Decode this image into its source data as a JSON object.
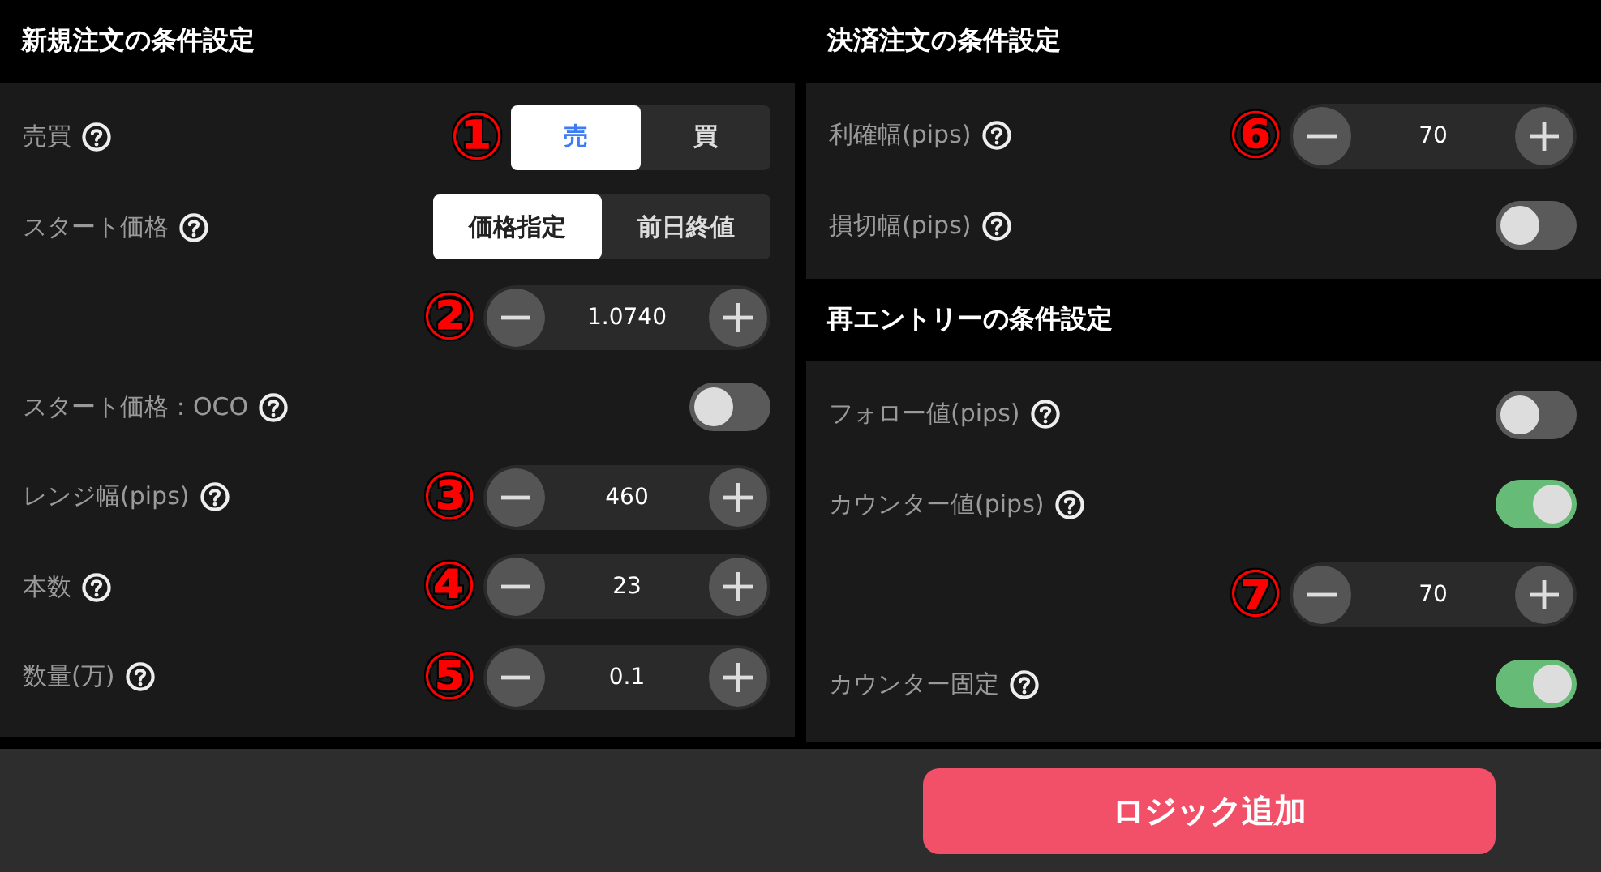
{
  "left": [
    {
      "title": "新規注文の条件設定",
      "rows": [
        {
          "kind": "segmented",
          "label": "売買",
          "help": true,
          "marker": "①",
          "options": [
            {
              "label": "売",
              "selected": true,
              "color": "#3d7cf5"
            },
            {
              "label": "買",
              "selected": false,
              "color": "#dddddd"
            }
          ]
        },
        {
          "kind": "segmented",
          "label": "スタート価格",
          "help": true,
          "options": [
            {
              "label": "価格指定",
              "selected": true,
              "color": "#222222"
            },
            {
              "label": "前日終値",
              "selected": false,
              "color": "#dddddd"
            }
          ]
        },
        {
          "kind": "stepper",
          "marker": "②",
          "value": "1.0740"
        },
        {
          "kind": "toggle",
          "label": "スタート価格：OCO",
          "help": true,
          "on": false
        },
        {
          "kind": "stepper",
          "label": "レンジ幅(pips)",
          "help": true,
          "marker": "③",
          "value": "460"
        },
        {
          "kind": "stepper",
          "label": "本数",
          "help": true,
          "marker": "④",
          "value": "23"
        },
        {
          "kind": "stepper",
          "label": "数量(万)",
          "help": true,
          "marker": "⑤",
          "value": "0.1"
        }
      ]
    }
  ],
  "right": [
    {
      "title": "決済注文の条件設定",
      "rows": [
        {
          "kind": "stepper",
          "label": "利確幅(pips)",
          "help": true,
          "marker": "⑥",
          "value": "70"
        },
        {
          "kind": "toggle",
          "label": "損切幅(pips)",
          "help": true,
          "on": false
        }
      ]
    },
    {
      "title": "再エントリーの条件設定",
      "rows": [
        {
          "kind": "toggle",
          "label": "フォロー値(pips)",
          "help": true,
          "on": false
        },
        {
          "kind": "toggle",
          "label": "カウンター値(pips)",
          "help": true,
          "on": true
        },
        {
          "kind": "stepper",
          "marker": "⑦",
          "value": "70"
        },
        {
          "kind": "toggle",
          "label": "カウンター固定",
          "help": true,
          "on": true
        }
      ]
    }
  ],
  "action_button": "ロジック追加"
}
